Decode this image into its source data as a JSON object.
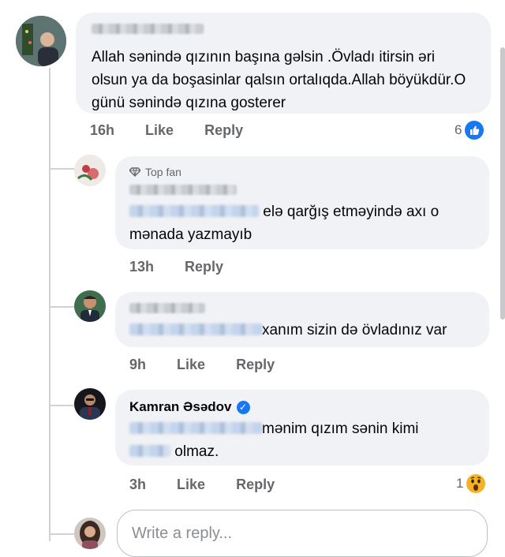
{
  "main_comment": {
    "text": "Allah sənində qızının başına gəlsin .Övladı itirsin əri olsun ya da boşasinlar qalsın ortalıqda.Allah böyükdür.O günü sənində qızına gosterer",
    "time": "16h",
    "like_label": "Like",
    "reply_label": "Reply",
    "reaction_count": "6",
    "reaction_icon": "like-reaction-icon"
  },
  "replies": [
    {
      "badge": "Top fan",
      "text_line1": "elə qarğış etməyində axı o",
      "text_line2": "mənada yazmayıb",
      "time": "13h",
      "reply_label": "Reply"
    },
    {
      "text": "xanım sizin də övladınız var",
      "time": "9h",
      "like_label": "Like",
      "reply_label": "Reply"
    },
    {
      "author": "Kamran Əsədov",
      "text_line1": "mənim qızım sənin kimi",
      "text_line2": "olmaz.",
      "time": "3h",
      "like_label": "Like",
      "reply_label": "Reply",
      "reaction_count": "1",
      "reaction_icon": "wow-reaction-icon"
    }
  ],
  "composer": {
    "placeholder": "Write a reply..."
  }
}
